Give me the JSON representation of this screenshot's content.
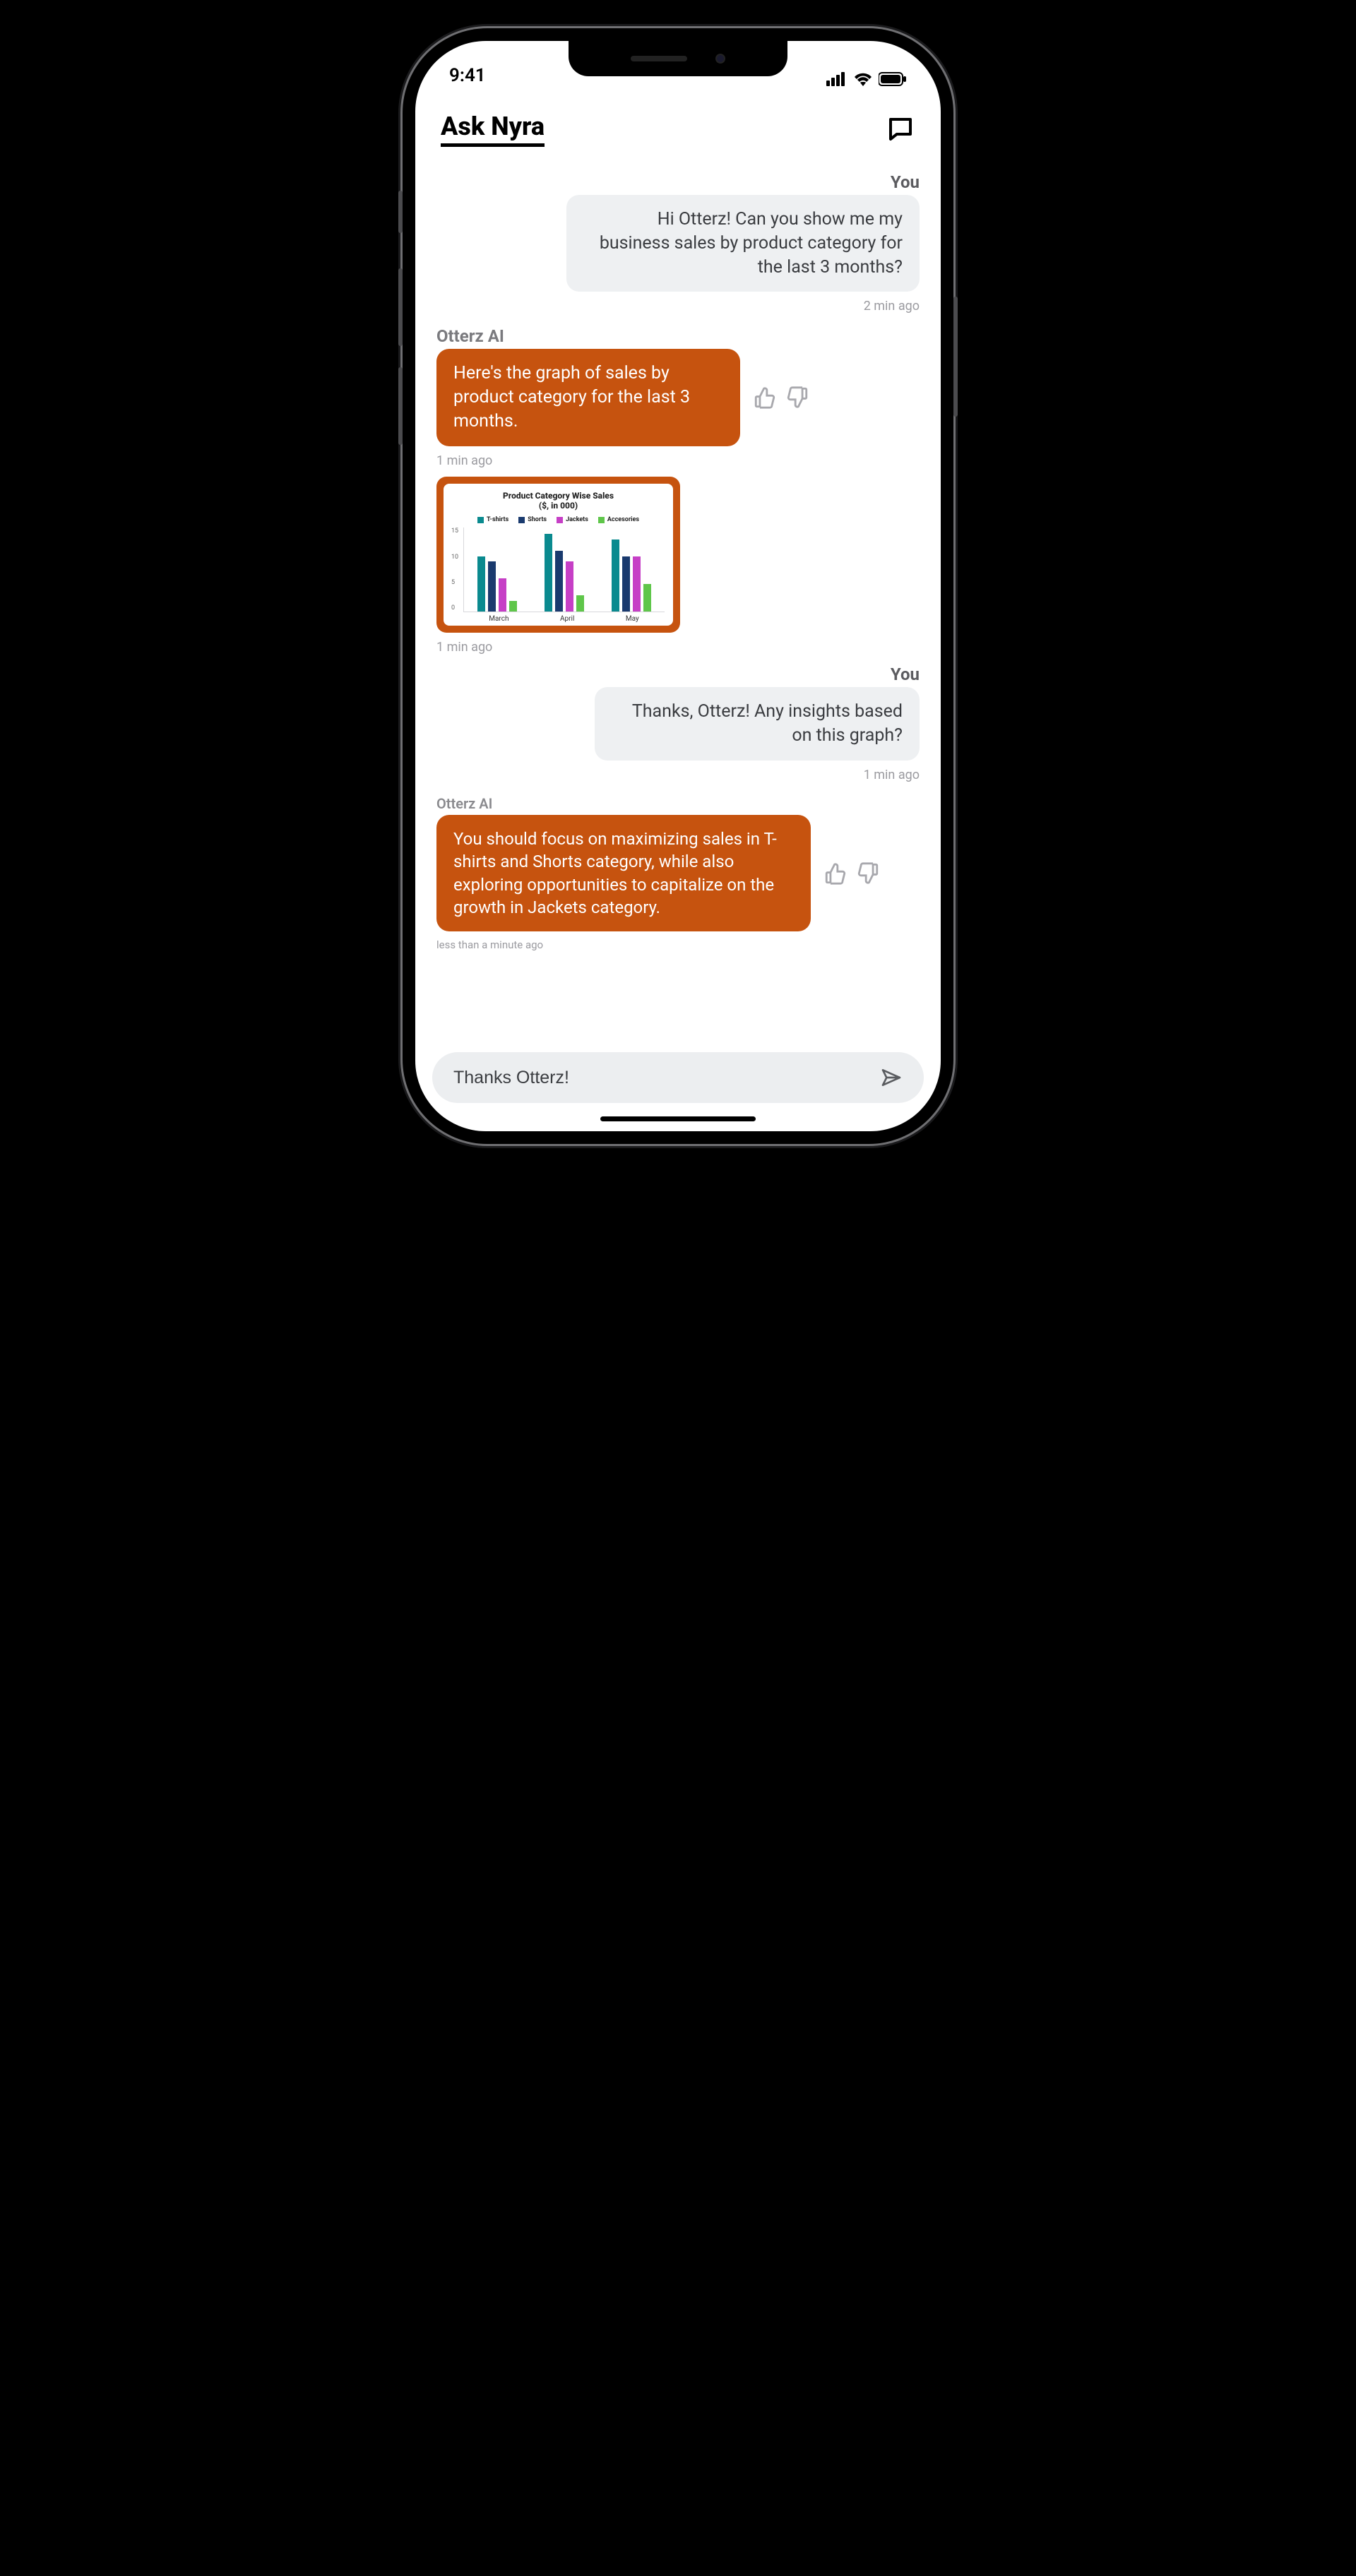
{
  "status": {
    "time": "9:41"
  },
  "header": {
    "title": "Ask Nyra"
  },
  "labels": {
    "you": "You",
    "bot": "Otterz AI"
  },
  "messages": {
    "m1": {
      "text": "Hi Otterz! Can you show me my business sales by product category for the last 3 months?",
      "ts": "2 min ago"
    },
    "m2": {
      "text": "Here's the graph of sales by product category for the last 3 months.",
      "ts": "1 min ago"
    },
    "chart_ts": "1 min ago",
    "m3": {
      "text": "Thanks, Otterz! Any insights based on this graph?",
      "ts": "1 min ago"
    },
    "m4": {
      "text": "You should focus on maximizing sales in T-shirts and Shorts category, while also exploring opportunities to capitalize on the growth in Jackets category.",
      "ts": "less than a minute ago"
    }
  },
  "input": {
    "value": "Thanks Otterz!"
  },
  "chart_data": {
    "type": "bar",
    "title": "Product Category Wise Sales",
    "subtitle": "($, in 000)",
    "categories": [
      "March",
      "April",
      "May"
    ],
    "series": [
      {
        "name": "T-shirts",
        "color": "#0a8a8f",
        "values": [
          10,
          14,
          13
        ]
      },
      {
        "name": "Shorts",
        "color": "#1a3a6e",
        "values": [
          9,
          11,
          10
        ]
      },
      {
        "name": "Jackets",
        "color": "#c63fc6",
        "values": [
          6,
          9,
          10
        ]
      },
      {
        "name": "Accesories",
        "color": "#5fc64a",
        "values": [
          2,
          3,
          5
        ]
      }
    ],
    "ylim": [
      0,
      15
    ],
    "yticks": [
      15,
      10,
      5,
      0
    ]
  }
}
